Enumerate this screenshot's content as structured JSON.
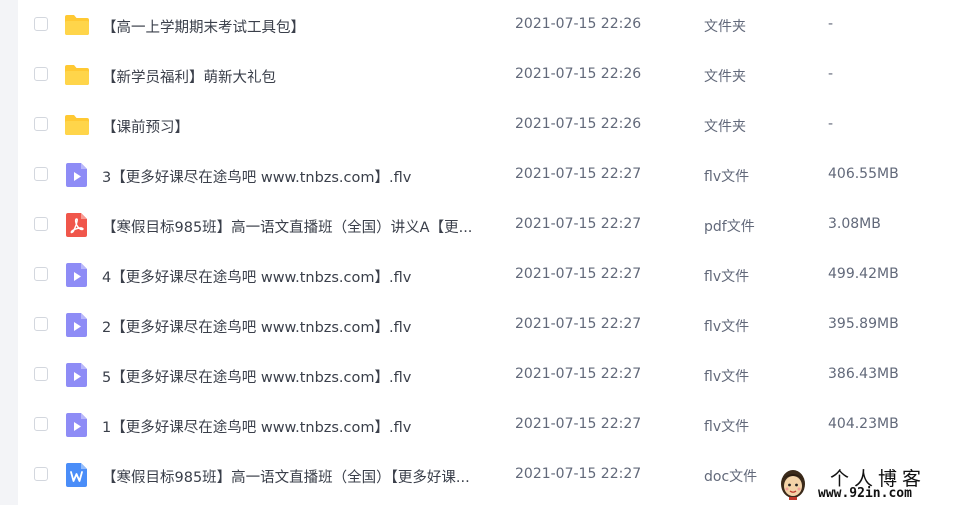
{
  "files": [
    {
      "icon": "folder-icon",
      "name": "【高一上学期期末考试工具包】",
      "time": "2021-07-15 22:26",
      "type": "文件夹",
      "size": "-"
    },
    {
      "icon": "folder-icon",
      "name": "【新学员福利】萌新大礼包",
      "time": "2021-07-15 22:26",
      "type": "文件夹",
      "size": "-"
    },
    {
      "icon": "folder-icon",
      "name": "【课前预习】",
      "time": "2021-07-15 22:26",
      "type": "文件夹",
      "size": "-"
    },
    {
      "icon": "video-file-icon",
      "name": "3【更多好课尽在途鸟吧 www.tnbzs.com】.flv",
      "time": "2021-07-15 22:27",
      "type": "flv文件",
      "size": "406.55MB"
    },
    {
      "icon": "pdf-file-icon",
      "name": "【寒假目标985班】高一语文直播班（全国）讲义A【更...",
      "time": "2021-07-15 22:27",
      "type": "pdf文件",
      "size": "3.08MB"
    },
    {
      "icon": "video-file-icon",
      "name": "4【更多好课尽在途鸟吧 www.tnbzs.com】.flv",
      "time": "2021-07-15 22:27",
      "type": "flv文件",
      "size": "499.42MB"
    },
    {
      "icon": "video-file-icon",
      "name": "2【更多好课尽在途鸟吧 www.tnbzs.com】.flv",
      "time": "2021-07-15 22:27",
      "type": "flv文件",
      "size": "395.89MB"
    },
    {
      "icon": "video-file-icon",
      "name": "5【更多好课尽在途鸟吧 www.tnbzs.com】.flv",
      "time": "2021-07-15 22:27",
      "type": "flv文件",
      "size": "386.43MB"
    },
    {
      "icon": "video-file-icon",
      "name": "1【更多好课尽在途鸟吧 www.tnbzs.com】.flv",
      "time": "2021-07-15 22:27",
      "type": "flv文件",
      "size": "404.23MB"
    },
    {
      "icon": "word-file-icon",
      "name": "【寒假目标985班】高一语文直播班（全国）【更多好课...",
      "time": "2021-07-15 22:27",
      "type": "doc文件",
      "size": ""
    }
  ],
  "watermark": {
    "title": "个人博客",
    "url": "www.92in.com"
  },
  "colors": {
    "folder": "#ffc933",
    "video": "#8e8cf6",
    "pdf": "#f0564b",
    "word": "#4a8df8"
  }
}
